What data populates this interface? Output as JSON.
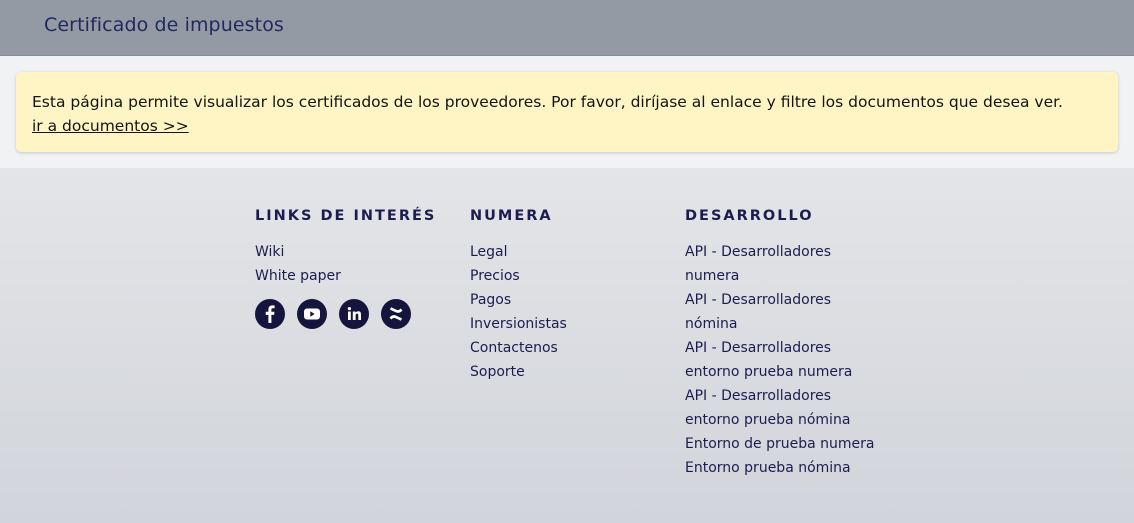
{
  "header": {
    "title": "Certificado de impuestos"
  },
  "alert": {
    "message": "Esta página permite visualizar los certificados de los proveedores. Por favor, diríjase al enlace y filtre los documentos que desea ver.",
    "link_label": "ir a documentos >>",
    "background": "#fef4c4"
  },
  "footer": {
    "links_col": {
      "heading": "LINKS DE INTERÉS",
      "items": [
        "Wiki",
        "White paper"
      ],
      "socials": [
        "facebook-icon",
        "youtube-icon",
        "linkedin-icon",
        "confluence-icon"
      ]
    },
    "numera_col": {
      "heading": "NUMERA",
      "items": [
        "Legal",
        "Precios",
        "Pagos",
        "Inversionistas",
        "Contactenos",
        "Soporte"
      ]
    },
    "dev_col": {
      "heading": "DESARROLLO",
      "items": [
        "API - Desarrolladores",
        "numera",
        "API - Desarrolladores",
        "nómina",
        "API - Desarrolladores",
        "entorno prueba numera",
        "API - Desarrolladores",
        "entorno prueba nómina",
        "Entorno de prueba numera",
        "Entorno prueba nómina"
      ]
    },
    "text_color": "#1c1d4f"
  }
}
